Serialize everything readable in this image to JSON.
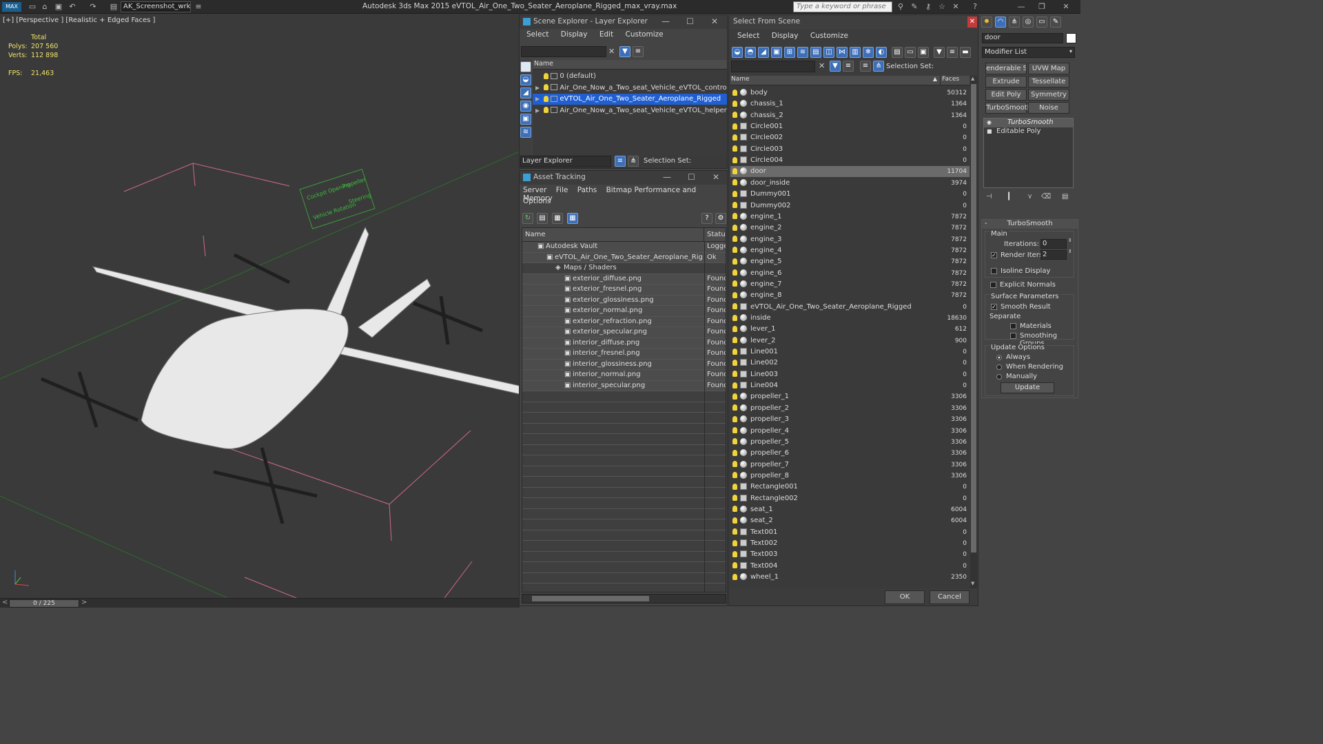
{
  "titlebar": {
    "workspace": "AK_Screenshot_wrksp",
    "title": "Autodesk 3ds Max  2015    eVTOL_Air_One_Two_Seater_Aeroplane_Rigged_max_vray.max",
    "search_placeholder": "Type a keyword or phrase"
  },
  "viewport": {
    "label": "[+] [Perspective ] [Realistic + Edged Faces ]",
    "stats": {
      "total_label": "Total",
      "polys_label": "Polys:",
      "polys_value": "207 560",
      "verts_label": "Verts:",
      "verts_value": "112 898",
      "fps_label": "FPS:",
      "fps_value": "21,463"
    },
    "frame_counter": "0 / 225",
    "helper_text": [
      "Cockpit Opening",
      "Propeller",
      "Vehicle Rotation",
      "Steering"
    ]
  },
  "scene_explorer": {
    "title": "Scene Explorer - Layer Explorer",
    "menu": [
      "Select",
      "Display",
      "Edit",
      "Customize"
    ],
    "column": "Name",
    "layers": [
      {
        "name": "0 (default)",
        "expandable": false,
        "selected": false
      },
      {
        "name": "Air_One_Now_a_Two_seat_Vehicle_eVTOL_controllers",
        "expandable": true,
        "selected": false
      },
      {
        "name": "eVTOL_Air_One_Two_Seater_Aeroplane_Rigged",
        "expandable": true,
        "selected": true
      },
      {
        "name": "Air_One_Now_a_Two_seat_Vehicle_eVTOL_helpers",
        "expandable": true,
        "selected": false
      }
    ],
    "footer_dropdown": "Layer Explorer",
    "selection_set_label": "Selection Set:"
  },
  "asset_tracking": {
    "title": "Asset Tracking",
    "menu_line1": [
      "Server",
      "File",
      "Paths",
      "Bitmap Performance and Memory"
    ],
    "menu_line2": [
      "Options"
    ],
    "columns": [
      "Name",
      "Status"
    ],
    "rows": [
      {
        "name": "Autodesk Vault",
        "status": "Logged",
        "indent": 0
      },
      {
        "name": "eVTOL_Air_One_Two_Seater_Aeroplane_Rigged_...",
        "status": "Ok",
        "indent": 1
      },
      {
        "name": "Maps / Shaders",
        "status": "",
        "indent": 2
      },
      {
        "name": "exterior_diffuse.png",
        "status": "Found",
        "indent": 3
      },
      {
        "name": "exterior_fresnel.png",
        "status": "Found",
        "indent": 3
      },
      {
        "name": "exterior_glossiness.png",
        "status": "Found",
        "indent": 3
      },
      {
        "name": "exterior_normal.png",
        "status": "Found",
        "indent": 3
      },
      {
        "name": "exterior_refraction.png",
        "status": "Found",
        "indent": 3
      },
      {
        "name": "exterior_specular.png",
        "status": "Found",
        "indent": 3
      },
      {
        "name": "interior_diffuse.png",
        "status": "Found",
        "indent": 3
      },
      {
        "name": "interior_fresnel.png",
        "status": "Found",
        "indent": 3
      },
      {
        "name": "interior_glossiness.png",
        "status": "Found",
        "indent": 3
      },
      {
        "name": "interior_normal.png",
        "status": "Found",
        "indent": 3
      },
      {
        "name": "interior_specular.png",
        "status": "Found",
        "indent": 3
      }
    ]
  },
  "select_from_scene": {
    "title": "Select From Scene",
    "menu": [
      "Select",
      "Display",
      "Customize"
    ],
    "selection_set_label": "Selection Set:",
    "columns": [
      "Name",
      "Faces"
    ],
    "objects": [
      {
        "name": "body",
        "faces": "50312",
        "kind": "mesh"
      },
      {
        "name": "chassis_1",
        "faces": "1364",
        "kind": "mesh"
      },
      {
        "name": "chassis_2",
        "faces": "1364",
        "kind": "mesh"
      },
      {
        "name": "Circle001",
        "faces": "0",
        "kind": "shape"
      },
      {
        "name": "Circle002",
        "faces": "0",
        "kind": "shape"
      },
      {
        "name": "Circle003",
        "faces": "0",
        "kind": "shape"
      },
      {
        "name": "Circle004",
        "faces": "0",
        "kind": "shape"
      },
      {
        "name": "door",
        "faces": "11704",
        "kind": "mesh",
        "selected": true
      },
      {
        "name": "door_inside",
        "faces": "3974",
        "kind": "mesh"
      },
      {
        "name": "Dummy001",
        "faces": "0",
        "kind": "helper"
      },
      {
        "name": "Dummy002",
        "faces": "0",
        "kind": "helper"
      },
      {
        "name": "engine_1",
        "faces": "7872",
        "kind": "mesh"
      },
      {
        "name": "engine_2",
        "faces": "7872",
        "kind": "mesh"
      },
      {
        "name": "engine_3",
        "faces": "7872",
        "kind": "mesh"
      },
      {
        "name": "engine_4",
        "faces": "7872",
        "kind": "mesh"
      },
      {
        "name": "engine_5",
        "faces": "7872",
        "kind": "mesh"
      },
      {
        "name": "engine_6",
        "faces": "7872",
        "kind": "mesh"
      },
      {
        "name": "engine_7",
        "faces": "7872",
        "kind": "mesh"
      },
      {
        "name": "engine_8",
        "faces": "7872",
        "kind": "mesh"
      },
      {
        "name": "eVTOL_Air_One_Two_Seater_Aeroplane_Rigged",
        "faces": "0",
        "kind": "group"
      },
      {
        "name": "inside",
        "faces": "18630",
        "kind": "mesh"
      },
      {
        "name": "lever_1",
        "faces": "612",
        "kind": "mesh"
      },
      {
        "name": "lever_2",
        "faces": "900",
        "kind": "mesh"
      },
      {
        "name": "Line001",
        "faces": "0",
        "kind": "shape"
      },
      {
        "name": "Line002",
        "faces": "0",
        "kind": "shape"
      },
      {
        "name": "Line003",
        "faces": "0",
        "kind": "shape"
      },
      {
        "name": "Line004",
        "faces": "0",
        "kind": "shape"
      },
      {
        "name": "propeller_1",
        "faces": "3306",
        "kind": "mesh"
      },
      {
        "name": "propeller_2",
        "faces": "3306",
        "kind": "mesh"
      },
      {
        "name": "propeller_3",
        "faces": "3306",
        "kind": "mesh"
      },
      {
        "name": "propeller_4",
        "faces": "3306",
        "kind": "mesh"
      },
      {
        "name": "propeller_5",
        "faces": "3306",
        "kind": "mesh"
      },
      {
        "name": "propeller_6",
        "faces": "3306",
        "kind": "mesh"
      },
      {
        "name": "propeller_7",
        "faces": "3306",
        "kind": "mesh"
      },
      {
        "name": "propeller_8",
        "faces": "3306",
        "kind": "mesh"
      },
      {
        "name": "Rectangle001",
        "faces": "0",
        "kind": "shape"
      },
      {
        "name": "Rectangle002",
        "faces": "0",
        "kind": "shape"
      },
      {
        "name": "seat_1",
        "faces": "6004",
        "kind": "mesh"
      },
      {
        "name": "seat_2",
        "faces": "6004",
        "kind": "mesh"
      },
      {
        "name": "Text001",
        "faces": "0",
        "kind": "shape"
      },
      {
        "name": "Text002",
        "faces": "0",
        "kind": "shape"
      },
      {
        "name": "Text003",
        "faces": "0",
        "kind": "shape"
      },
      {
        "name": "Text004",
        "faces": "0",
        "kind": "shape"
      },
      {
        "name": "wheel_1",
        "faces": "2350",
        "kind": "mesh"
      }
    ],
    "ok_label": "OK",
    "cancel_label": "Cancel"
  },
  "command_panel": {
    "object_name": "door",
    "modifier_list_label": "Modifier List",
    "modifier_buttons": [
      "enderable Splir",
      "UVW Map",
      "Extrude",
      "Tessellate",
      "Edit Poly",
      "Symmetry",
      "TurboSmooth",
      "Noise"
    ],
    "stack": [
      "TurboSmooth",
      "Editable Poly"
    ],
    "rollout_title": "TurboSmooth",
    "main_label": "Main",
    "iterations_label": "Iterations:",
    "iterations_value": "0",
    "render_iters_label": "Render Iters:",
    "render_iters_value": "2",
    "render_iters_checked": true,
    "isoline_label": "Isoline Display",
    "explicit_normals_label": "Explicit Normals",
    "surface_params_label": "Surface Parameters",
    "smooth_result_label": "Smooth Result",
    "separate_label": "Separate",
    "materials_label": "Materials",
    "smoothing_groups_label": "Smoothing Groups",
    "update_options_label": "Update Options",
    "always_label": "Always",
    "when_rendering_label": "When Rendering",
    "manually_label": "Manually",
    "update_button_label": "Update",
    "selected_update_option": "Always"
  },
  "colors": {
    "selection_blue": "#1f5fd1",
    "stats_yellow": "#f0e46a",
    "found_row_bg": "#4c4c4c"
  }
}
